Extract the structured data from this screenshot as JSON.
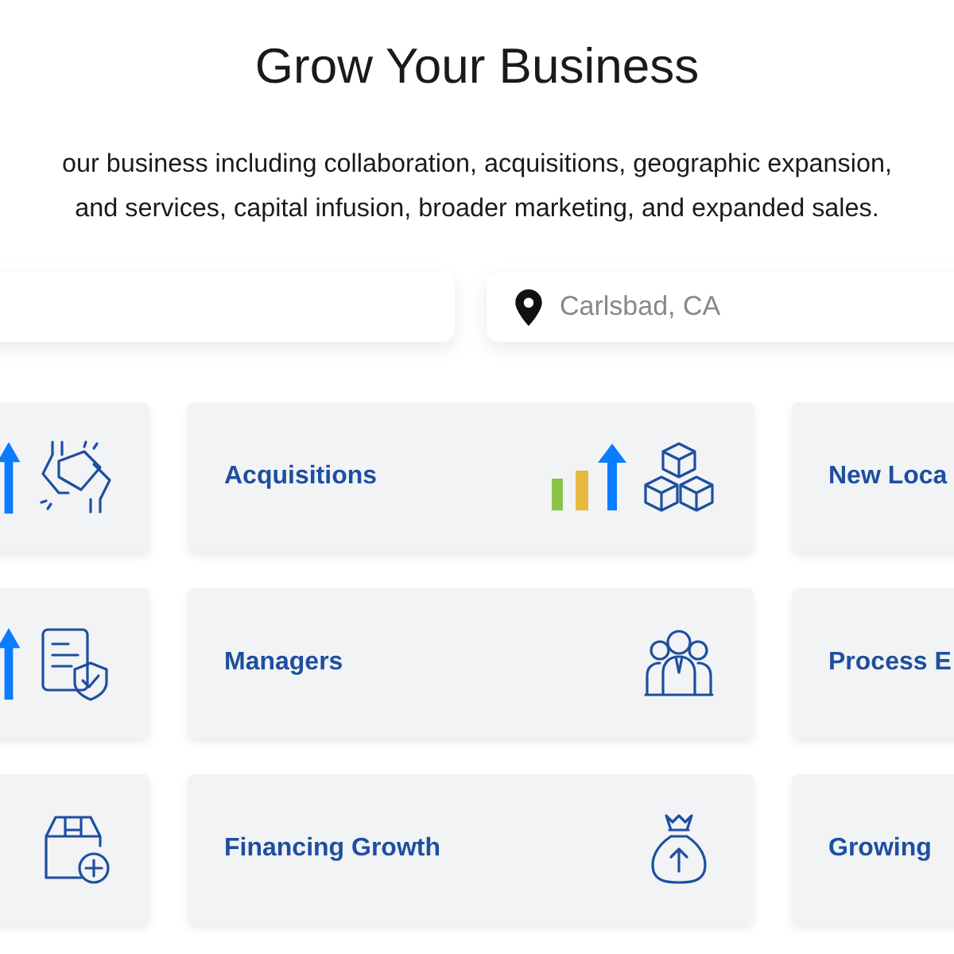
{
  "heading": "Grow Your Business",
  "intro_lines": [
    "our business including collaboration, acquisitions, geographic expansion,",
    "and services, capital infusion, broader marketing, and expanded sales."
  ],
  "search_fields": [
    {
      "kind": "plain"
    },
    {
      "kind": "location",
      "placeholder": "Carlsbad, CA"
    }
  ],
  "card_rows": [
    [
      {},
      {
        "label": "Acquisitions"
      },
      {
        "label": "New Loca"
      }
    ],
    [
      {},
      {
        "label": "Managers"
      },
      {
        "label": "Process E"
      }
    ],
    [
      {},
      {
        "label": "Financing Growth"
      },
      {
        "label": "Growing"
      }
    ]
  ]
}
